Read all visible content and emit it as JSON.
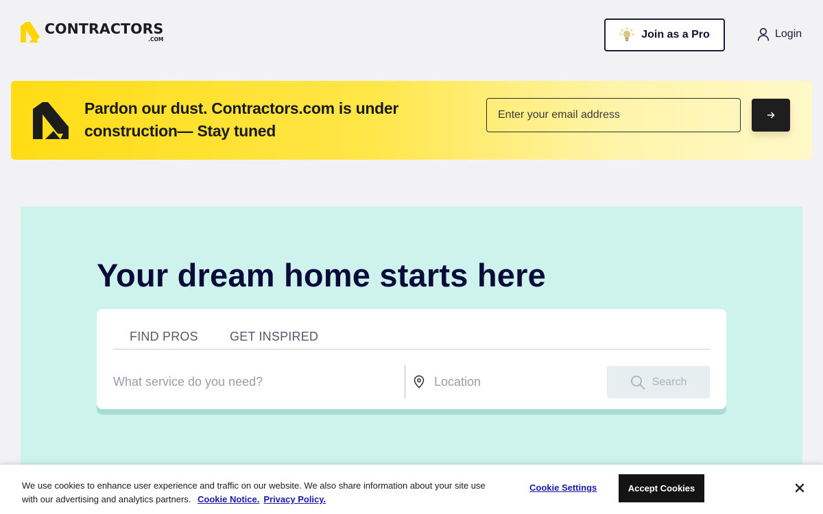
{
  "brand": {
    "name": "CONTRACTORS",
    "suffix": ".COM",
    "accent_color": "#ffdc14"
  },
  "header": {
    "join_label": "Join as a Pro",
    "join_icon": "lightbulb-icon",
    "login_label": "Login",
    "login_icon": "user-icon"
  },
  "banner": {
    "message": "Pardon our dust. Contractors.com is under construction— Stay tuned",
    "email_placeholder": "Enter your email address",
    "submit_icon": "arrow-right-icon"
  },
  "hero": {
    "title": "Your dream home starts here",
    "background_color": "#cdf3ec",
    "tabs": [
      {
        "label": "FIND PROS"
      },
      {
        "label": "GET INSPIRED"
      }
    ],
    "service_placeholder": "What service do you need?",
    "location_placeholder": "Location",
    "search_label": "Search"
  },
  "cookie": {
    "text": "We use cookies to enhance user experience and traffic on our website. We also share information about your site use with our advertising and analytics partners.",
    "notice_link": "Cookie Notice.",
    "privacy_link": "Privacy Policy.",
    "settings_label": "Cookie Settings",
    "accept_label": "Accept Cookies"
  }
}
